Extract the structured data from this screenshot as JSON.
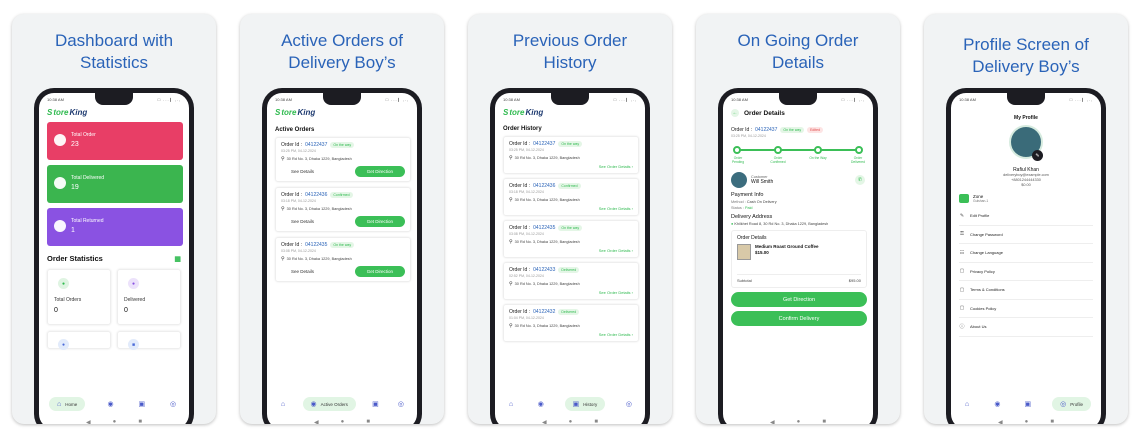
{
  "screens": [
    {
      "caption": "Dashboard with Statistics"
    },
    {
      "caption": "Active Orders of Delivery Boy’s"
    },
    {
      "caption": "Previous Order History"
    },
    {
      "caption": "On Going Order Details"
    },
    {
      "caption": "Profile Screen of Delivery Boy’s"
    }
  ],
  "status_bar": {
    "time": "10:38 AM",
    "icons": "□ ...∥ ,.,"
  },
  "logo": {
    "s": "S",
    "rest": "tore",
    "k": "King"
  },
  "colors": {
    "accent": "#3bbf57",
    "caption": "#2a63b8",
    "total_order": "#e83e66",
    "total_delivered": "#3bb54f",
    "total_returned": "#8a52e2"
  },
  "dashboard": {
    "tiles": [
      {
        "label": "Total Order",
        "value": "23"
      },
      {
        "label": "Total Delivered",
        "value": "19"
      },
      {
        "label": "Total Returned",
        "value": "1"
      }
    ],
    "stats_title": "Order Statistics",
    "stats": [
      {
        "label": "Total Orders",
        "value": "0"
      },
      {
        "label": "Delivered",
        "value": "0"
      }
    ]
  },
  "tabs": {
    "home": "Home",
    "active_orders": "Active Orders",
    "history": "History",
    "profile": "Profile"
  },
  "active_orders": {
    "title": "Active Orders",
    "orders": [
      {
        "label": "Order Id :",
        "id": "04122437",
        "status": "On the way",
        "time": "03:25 PM, 04-12-2024",
        "address": "30 Rd No. 3, Dhaka 1229, Bangladesh",
        "details": "See Details",
        "direction": "Get Direction"
      },
      {
        "label": "Order Id :",
        "id": "04122436",
        "status": "Confirmed",
        "time": "03:18 PM, 04-12-2024",
        "address": "30 Rd No. 3, Dhaka 1229, Bangladesh",
        "details": "See Details",
        "direction": "Get Direction"
      },
      {
        "label": "Order Id :",
        "id": "04122435",
        "status": "On the way",
        "time": "03:08 PM, 04-12-2024",
        "address": "30 Rd No. 3, Dhaka 1229, Bangladesh",
        "details": "See Details",
        "direction": "Get Direction"
      }
    ]
  },
  "history": {
    "title": "Order History",
    "link": "See Order Details ›",
    "orders": [
      {
        "label": "Order Id :",
        "id": "04122437",
        "status": "On the way",
        "time": "03:25 PM, 04-12-2024",
        "address": "30 Rd No. 3, Dhaka 1229, Bangladesh"
      },
      {
        "label": "Order Id :",
        "id": "04122436",
        "status": "Confirmed",
        "time": "03:18 PM, 04-12-2024",
        "address": "30 Rd No. 3, Dhaka 1229, Bangladesh"
      },
      {
        "label": "Order Id :",
        "id": "04122435",
        "status": "On the way",
        "time": "03:08 PM, 04-12-2024",
        "address": "30 Rd No. 3, Dhaka 1229, Bangladesh"
      },
      {
        "label": "Order Id :",
        "id": "04122433",
        "status": "Delivered",
        "time": "02:52 PM, 04-12-2024",
        "address": "30 Rd No. 3, Dhaka 1229, Bangladesh"
      },
      {
        "label": "Order Id :",
        "id": "04122432",
        "status": "Delivered",
        "time": "01:04 PM, 04-12-2024",
        "address": "30 Rd No. 3, Dhaka 1229, Bangladesh"
      }
    ]
  },
  "details": {
    "title": "Order Details",
    "order_label": "Order Id :",
    "order_id": "04122437",
    "status": "On the way",
    "status2": "Edited",
    "time": "03:25 PM, 04-12-2024",
    "steps": [
      "Order Pending",
      "Order Confirmed",
      "On the Way",
      "Order Delivered"
    ],
    "customer_label": "Customer",
    "customer_name": "Will Smith",
    "payment_title": "Payment Info",
    "method_label": "Method :",
    "method_value": "Cash On Delivery",
    "payment_status_label": "Status :",
    "payment_status_value": "Paid",
    "address_title": "Delivery Address",
    "address": "Khilkhet Road 8, 30 Rd No. 3, Dhaka 1229, Bangladesh",
    "od_title": "Order Details",
    "product_name": "Medium Roast Ground Coffee",
    "product_price": "$15.00",
    "subtotal_label": "Subtotal",
    "subtotal_value": "$95.00",
    "btn_direction": "Get Direction",
    "btn_confirm": "Confirm Delivery"
  },
  "profile": {
    "title": "My Profile",
    "name": "Rafiul Khan",
    "email": "deliveryboy@example.com",
    "phone": "+8801244444330",
    "balance": "$0.00",
    "zone_title": "Zone",
    "zone_value": "Gulshan-1",
    "menu": [
      {
        "label": "Edit Profile",
        "icon": "✎"
      },
      {
        "label": "Change Password",
        "icon": "⚿"
      },
      {
        "label": "Change Language",
        "icon": "☷"
      },
      {
        "label": "Privacy Policy",
        "icon": "▢"
      },
      {
        "label": "Terms & Conditions",
        "icon": "▢"
      },
      {
        "label": "Cookies Policy",
        "icon": "▢"
      },
      {
        "label": "About Us",
        "icon": "ⓘ"
      }
    ]
  }
}
